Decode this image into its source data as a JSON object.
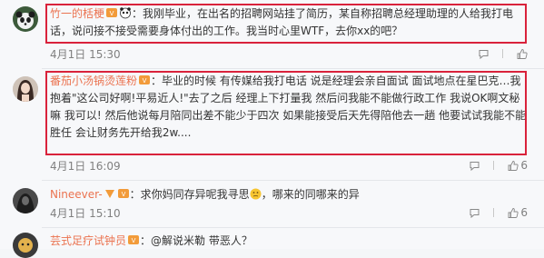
{
  "comments": [
    {
      "username": "竹一的栝梗",
      "text": "：我刚毕业，在出名的招聘网站挂了简历，某自称招聘总经理助理的人给我打电话，说问接不接受需要身体付出的工作。我当时心里WTF，去你xx的吧？",
      "time": "4月1日 15:30",
      "reply_label": "回复",
      "like_count": ""
    },
    {
      "username": "番茄小汤锅烫莲粉",
      "text": "：毕业的时候 有传媒给我打电话 说是经理会亲自面试 面试地点在星巴克…我抱着\"这公司好啊!平易近人!\"去了之后 经理上下打量我 然后问我能不能做行政工作 我说OK啊文秘嘛 我可以! 然后他说每月陪同出差不能少于四次 如果能接受后天先得陪他去一趟 他要试试我能不能胜任 会让财务先开给我2w....",
      "time": "4月1日 16:09",
      "reply_label": "回复",
      "like_count": "6"
    },
    {
      "username": "Nineever-",
      "text": "：求你妈同存异呢我寻思",
      "text_after": "，哪来的同哪来的异",
      "time": "4月1日 15:10",
      "reply_label": "回复",
      "like_count": "6"
    },
    {
      "username": "芸式足疗试钟员",
      "text": "：@解说米勒  带恶人？",
      "time": "",
      "reply_label": "",
      "like_count": ""
    }
  ],
  "colors": {
    "username": "#eb7350",
    "text": "#333333",
    "meta": "#808080",
    "highlight": "#d9223b",
    "background": "#f7f8fa"
  },
  "icons": {
    "reply": "reply-icon",
    "like": "thumbs-up-icon",
    "vip": "vip-badge-icon"
  }
}
